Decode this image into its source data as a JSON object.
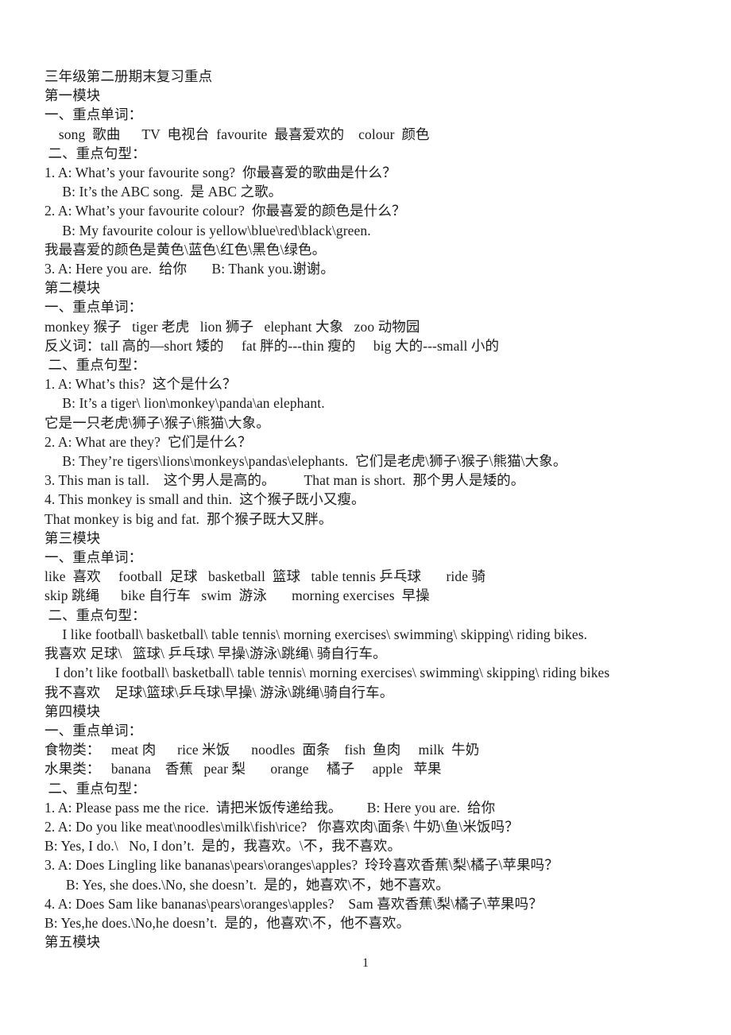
{
  "document": {
    "title": "三年级第二册期末复习重点",
    "page_number": "1"
  },
  "lines": [
    {
      "id": "doc-title",
      "text": "三年级第二册期末复习重点",
      "indent": "none"
    },
    {
      "id": "module-1-heading",
      "text": "第一模块",
      "indent": "none"
    },
    {
      "id": "m1-words-heading",
      "text": "一、重点单词：",
      "indent": "none"
    },
    {
      "id": "m1-words",
      "text": "    song  歌曲      TV  电视台  favourite  最喜爱欢的    colour  颜色",
      "indent": "none"
    },
    {
      "id": "m1-sent-heading",
      "text": " 二、重点句型：",
      "indent": "none"
    },
    {
      "id": "m1-s1a",
      "text": "1. A: What’s your favourite song?  你最喜爱的歌曲是什么？",
      "indent": "none"
    },
    {
      "id": "m1-s1b",
      "text": "     B: It’s the ABC song.  是 ABC 之歌。",
      "indent": "none"
    },
    {
      "id": "m1-s2a",
      "text": "2. A: What’s your favourite colour?  你最喜爱的颜色是什么？",
      "indent": "none"
    },
    {
      "id": "m1-s2b",
      "text": "     B: My favourite colour is yellow\\blue\\red\\black\\green.",
      "indent": "none"
    },
    {
      "id": "m1-s2c",
      "text": "我最喜爱的颜色是黄色\\蓝色\\红色\\黑色\\绿色。",
      "indent": "none"
    },
    {
      "id": "m1-s3",
      "text": "3. A: Here you are.  给你       B: Thank you.谢谢。",
      "indent": "none"
    },
    {
      "id": "module-2-heading",
      "text": "第二模块",
      "indent": "none"
    },
    {
      "id": "m2-words-heading",
      "text": "一、重点单词：",
      "indent": "none"
    },
    {
      "id": "m2-words",
      "text": "monkey 猴子   tiger 老虎   lion 狮子   elephant 大象   zoo 动物园",
      "indent": "none"
    },
    {
      "id": "m2-antonyms",
      "text": "反义词：tall 高的—short 矮的     fat 胖的---thin 瘦的     big 大的---small 小的",
      "indent": "none"
    },
    {
      "id": "m2-sent-heading",
      "text": " 二、重点句型：",
      "indent": "none"
    },
    {
      "id": "m2-s1a",
      "text": "1. A: What’s this?  这个是什么？",
      "indent": "none"
    },
    {
      "id": "m2-s1b",
      "text": "     B: It’s a tiger\\ lion\\monkey\\panda\\an elephant.",
      "indent": "none"
    },
    {
      "id": "m2-s1c",
      "text": "它是一只老虎\\狮子\\猴子\\熊猫\\大象。",
      "indent": "none"
    },
    {
      "id": "m2-s2a",
      "text": "2. A: What are they?  它们是什么？",
      "indent": "none"
    },
    {
      "id": "m2-s2b",
      "text": "     B: They’re tigers\\lions\\monkeys\\pandas\\elephants.  它们是老虎\\狮子\\猴子\\熊猫\\大象。",
      "indent": "none"
    },
    {
      "id": "m2-s3",
      "text": "3. This man is tall.    这个男人是高的。        That man is short.  那个男人是矮的。",
      "indent": "none"
    },
    {
      "id": "m2-s4",
      "text": "4. This monkey is small and thin.  这个猴子既小又瘦。",
      "indent": "none"
    },
    {
      "id": "m2-s5",
      "text": "That monkey is big and fat.  那个猴子既大又胖。",
      "indent": "none"
    },
    {
      "id": "module-3-heading",
      "text": "第三模块",
      "indent": "none"
    },
    {
      "id": "m3-words-heading",
      "text": "一、重点单词：",
      "indent": "none"
    },
    {
      "id": "m3-words-1",
      "text": "like  喜欢     football  足球   basketball  篮球   table tennis 乒乓球       ride 骑",
      "indent": "none"
    },
    {
      "id": "m3-words-2",
      "text": "skip 跳绳      bike 自行车   swim  游泳       morning exercises  早操",
      "indent": "none"
    },
    {
      "id": "m3-sent-heading",
      "text": " 二、重点句型：",
      "indent": "none"
    },
    {
      "id": "m3-s1",
      "text": "     I like football\\ basketball\\ table tennis\\ morning exercises\\ swimming\\ skipping\\ riding bikes.",
      "indent": "none"
    },
    {
      "id": "m3-s1-cn",
      "text": "我喜欢 足球\\   篮球\\ 乒乓球\\ 早操\\游泳\\跳绳\\ 骑自行车。",
      "indent": "none"
    },
    {
      "id": "m3-s2",
      "text": "   I don’t like football\\ basketball\\ table tennis\\ morning exercises\\ swimming\\ skipping\\ riding bikes",
      "indent": "none"
    },
    {
      "id": "m3-s2-cn",
      "text": "我不喜欢    足球\\篮球\\乒乓球\\早操\\ 游泳\\跳绳\\骑自行车。",
      "indent": "none"
    },
    {
      "id": "module-4-heading",
      "text": "第四模块",
      "indent": "none"
    },
    {
      "id": "m4-words-heading",
      "text": "一、重点单词：",
      "indent": "none"
    },
    {
      "id": "m4-words-food",
      "text": "食物类：   meat 肉      rice 米饭      noodles  面条    fish  鱼肉     milk  牛奶",
      "indent": "none"
    },
    {
      "id": "m4-words-fruit",
      "text": "水果类：   banana    香蕉   pear 梨       orange     橘子     apple   苹果",
      "indent": "none"
    },
    {
      "id": "m4-sent-heading",
      "text": " 二、重点句型：",
      "indent": "none"
    },
    {
      "id": "m4-s1",
      "text": "1. A: Please pass me the rice.  请把米饭传递给我。       B: Here you are.  给你",
      "indent": "none"
    },
    {
      "id": "m4-s2a",
      "text": "2. A: Do you like meat\\noodles\\milk\\fish\\rice?   你喜欢肉\\面条\\ 牛奶\\鱼\\米饭吗？",
      "indent": "none"
    },
    {
      "id": "m4-s2b",
      "text": "B: Yes, I do.\\   No, I don’t.  是的，我喜欢。\\不，我不喜欢。",
      "indent": "none"
    },
    {
      "id": "m4-s3a",
      "text": "3. A: Does Lingling like bananas\\pears\\oranges\\apples?  玲玲喜欢香蕉\\梨\\橘子\\苹果吗？",
      "indent": "none"
    },
    {
      "id": "m4-s3b",
      "text": "      B: Yes, she does.\\No, she doesn’t.  是的，她喜欢\\不，她不喜欢。",
      "indent": "none"
    },
    {
      "id": "m4-s4a",
      "text": "4. A: Does Sam like bananas\\pears\\oranges\\apples?    Sam 喜欢香蕉\\梨\\橘子\\苹果吗？",
      "indent": "none"
    },
    {
      "id": "m4-s4b",
      "text": "B: Yes,he does.\\No,he doesn’t.  是的，他喜欢\\不，他不喜欢。",
      "indent": "none"
    },
    {
      "id": "module-5-heading",
      "text": "第五模块",
      "indent": "none"
    }
  ]
}
